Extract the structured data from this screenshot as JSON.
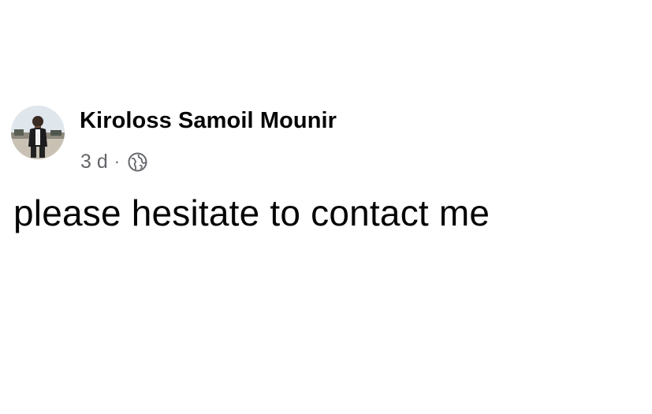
{
  "post": {
    "author": {
      "name": "Kiroloss Samoil Mounir",
      "avatar": "profile-photo"
    },
    "meta": {
      "timestamp": "3 d",
      "separator": "·",
      "privacy_icon": "globe-icon"
    },
    "text": "please hesitate to contact me"
  },
  "colors": {
    "background": "#ffffff",
    "name_text": "#050505",
    "meta_text": "#65676b",
    "body_text": "#050505"
  }
}
